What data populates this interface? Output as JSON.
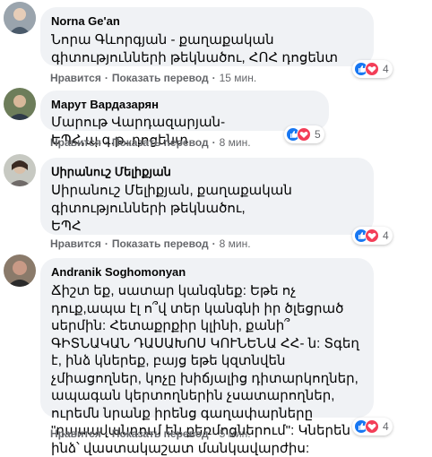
{
  "comments": [
    {
      "author": "Norna Ge'an",
      "text": "Նորա Գևորգյան - քաղաքական գիտությունների թեկնածու, ՀՈՀ դոցենտ",
      "like_label": "Нравится",
      "translate_label": "Показать перевод",
      "time": "15 мин.",
      "reaction_count": "4"
    },
    {
      "author": "Марут Вардазарян",
      "text": "Մարութ Վարդազարյան-ԵՊՀ,պ.գ.թ.,դոցենտ",
      "like_label": "Нравится",
      "translate_label": "Показать перевод",
      "time": "8 мин.",
      "reaction_count": "5"
    },
    {
      "author": "Սիրանուշ Մելիքյան",
      "text": "Սիրանուշ Մելիքյան, քաղաքական գիտությունների թեկնածու,\nԵՊՀ",
      "like_label": "Нравится",
      "translate_label": "Показать перевод",
      "time": "8 мин.",
      "reaction_count": "4"
    },
    {
      "author": "Andranik Soghomonyan",
      "text": "Ճիշտ եք, սատար կանգնեք: Եթե ոչ դուք,ապա էլ ո՞վ տեր կանգնի իր ծլեցրած սերմին: Հետաքրքիր կլինի, քանի՞ ԳԻՏՆԱԿԱՆ ԴԱՍԱԽՈՍ ԿՈՒՆԵՆԱ ՀՀ- ն: Տգեղ է, ինձ կներեք, բայց եթե կզտնվեն չմիացողներ, կոչը խիճյալից դիտարկողներ, ապագան կերտողներին չսատարողներ, ուրեմն նրանք իրենց գաղափարները \"դասավանդում են քեռմոցներում\": Կներեն ինձ՝ վաստակաշատ մանկավարժիս:",
      "like_label": "Нравится",
      "translate_label": "Показать перевод",
      "time": "5 мин.",
      "reaction_count": "4"
    }
  ],
  "colors": {
    "bubble": "#f0f2f5",
    "meta": "#65676b",
    "like": "#1877f2",
    "love": "#f33e58"
  }
}
